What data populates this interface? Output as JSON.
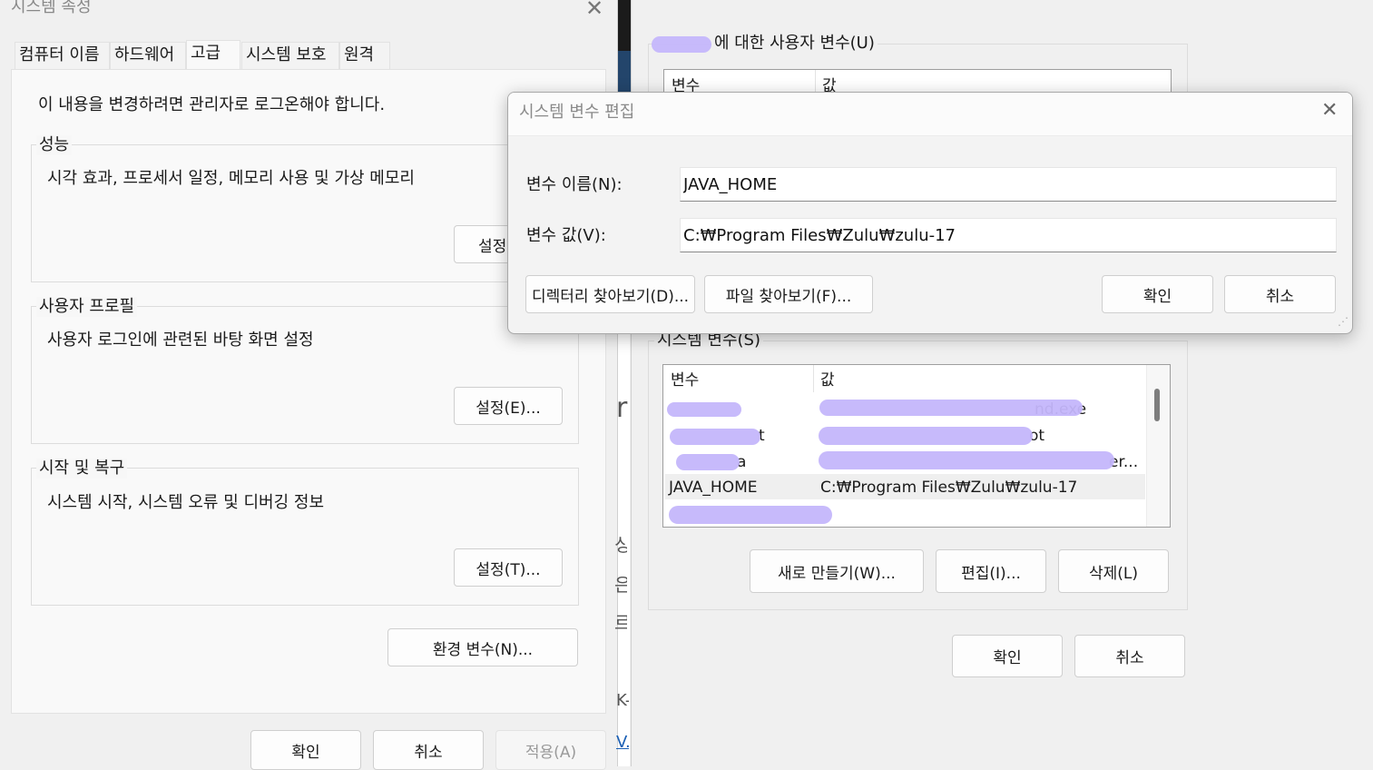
{
  "sys_props": {
    "title": "시스템 속성",
    "tabs": [
      "컴퓨터 이름",
      "하드웨어",
      "고급",
      "시스템 보호",
      "원격"
    ],
    "admin_note": "이 내용을 변경하려면 관리자로 로그온해야 합니다.",
    "performance": {
      "legend": "성능",
      "desc": "시각 효과, 프로세서 일정, 메모리 사용 및 가상 메모리",
      "button": "설정"
    },
    "profile": {
      "legend": "사용자 프로필",
      "desc": "사용자 로그인에 관련된 바탕 화면 설정",
      "button": "설정(E)..."
    },
    "startup": {
      "legend": "시작 및 복구",
      "desc": "시스템 시작, 시스템 오류 및 디버깅 정보",
      "button": "설정(T)..."
    },
    "env_button": "환경 변수(N)...",
    "ok": "확인",
    "cancel": "취소",
    "apply": "적용(A)"
  },
  "env_vars": {
    "user_legend": "에 대한 사용자 변수(U)",
    "user_headers": [
      "변수",
      "값"
    ],
    "system_legend": "시스템 변수(S)",
    "system_headers": [
      "변수",
      "값"
    ],
    "system_rows": [
      {
        "name": "",
        "value": "nd.exe"
      },
      {
        "name": "t",
        "value": "ot"
      },
      {
        "name": "a",
        "value": "er..."
      },
      {
        "name": "JAVA_HOME",
        "value": "C:₩Program Files₩Zulu₩zulu-17"
      },
      {
        "name": "",
        "value": ""
      }
    ],
    "new_button": "새로 만들기(W)...",
    "edit_button": "편집(I)...",
    "delete_button": "삭제(L)",
    "ok": "확인",
    "cancel": "취소"
  },
  "edit_dialog": {
    "title": "시스템 변수 편집",
    "name_label": "변수 이름(N):",
    "name_value": "JAVA_HOME",
    "value_label": "변수 값(V):",
    "value_value": "C:₩Program Files₩Zulu₩zulu-17",
    "browse_dir": "디렉터리 찾아보기(D)...",
    "browse_file": "파일 찾아보기(F)...",
    "ok": "확인",
    "cancel": "취소"
  },
  "background": {
    "glyphs": [
      "ri",
      "싱",
      "은",
      "르",
      "K-",
      "V."
    ]
  },
  "colors": {
    "redact": "#c4b6fb",
    "accent_link": "#1a5fb4"
  }
}
